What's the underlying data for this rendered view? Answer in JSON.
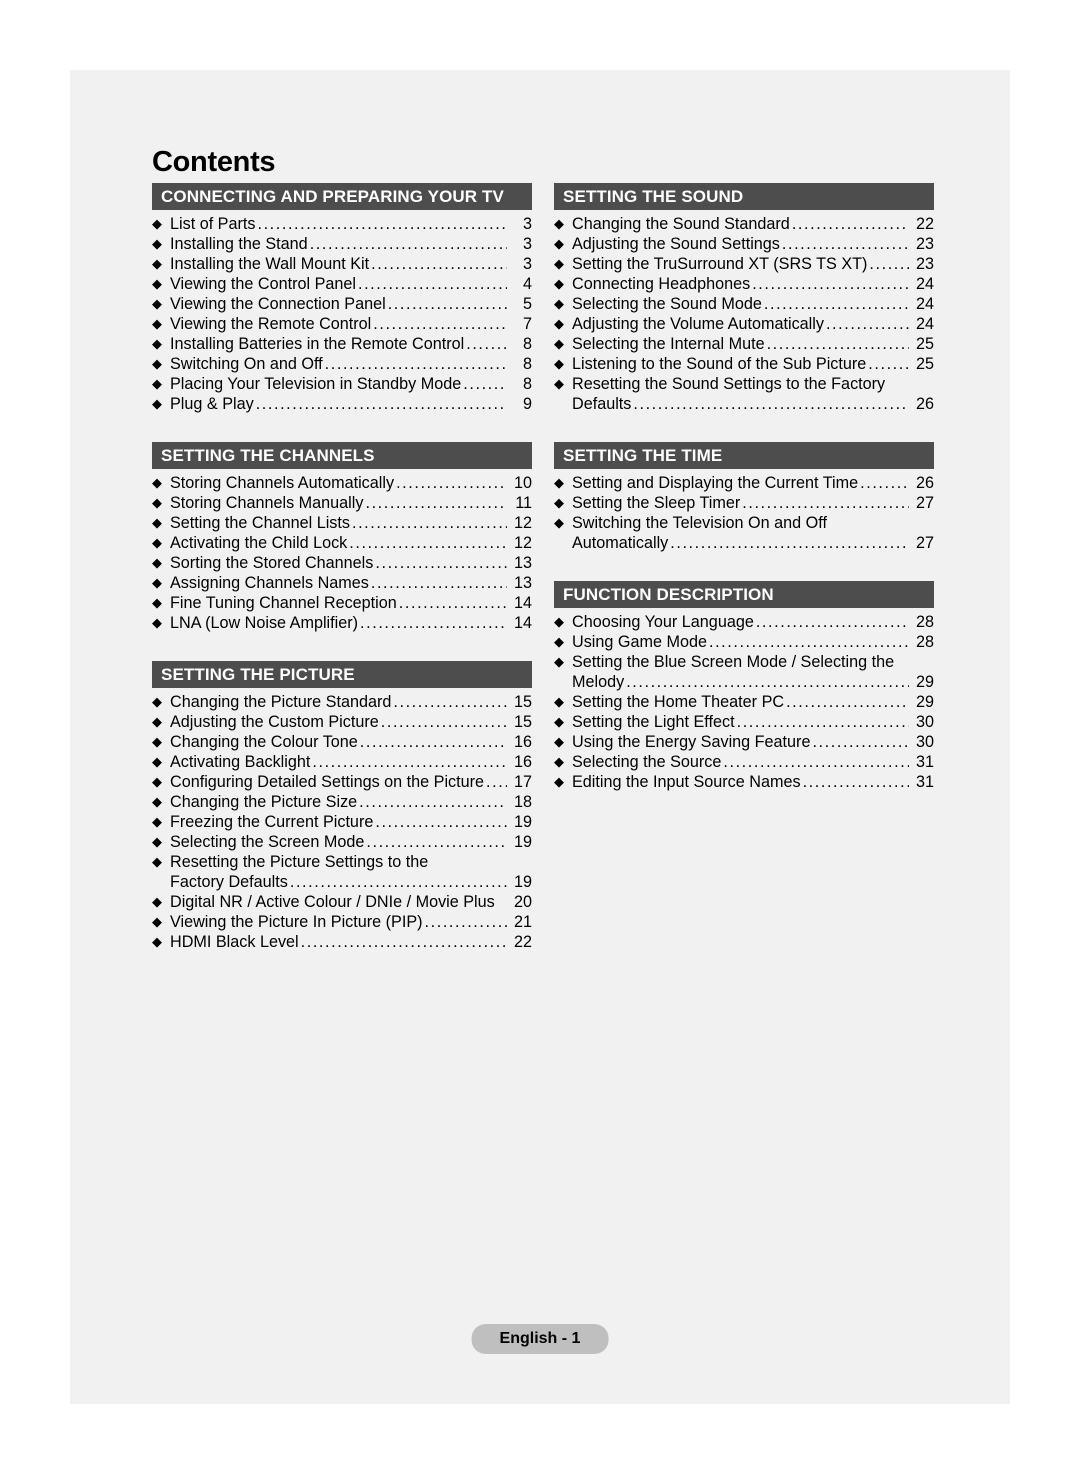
{
  "document": {
    "title": "Contents",
    "bullet_glyph": "◆",
    "footer_label": "English - 1",
    "colors": {
      "page_background": "#f1f1f1",
      "section_bar": "#4d4d4d",
      "section_bar_text": "#ffffff",
      "body_text": "#000000",
      "footer_badge": "#bfbfbf"
    }
  },
  "columns": [
    {
      "name": "left-column",
      "sections": [
        {
          "heading": "CONNECTING AND PREPARING YOUR TV",
          "items": [
            {
              "label": "List of Parts",
              "page": "3",
              "leader": true
            },
            {
              "label": "Installing the Stand",
              "page": "3",
              "leader": true
            },
            {
              "label": "Installing the Wall Mount Kit",
              "page": "3",
              "leader": true
            },
            {
              "label": "Viewing the Control Panel",
              "page": "4",
              "leader": true
            },
            {
              "label": "Viewing the Connection Panel",
              "page": "5",
              "leader": true
            },
            {
              "label": "Viewing the Remote Control",
              "page": "7",
              "leader": true
            },
            {
              "label": "Installing Batteries in the Remote Control",
              "page": "8",
              "leader": true
            },
            {
              "label": "Switching On and Off",
              "page": "8",
              "leader": true
            },
            {
              "label": "Placing Your Television in Standby Mode",
              "page": "8",
              "leader": true
            },
            {
              "label": "Plug & Play",
              "page": "9",
              "leader": true
            }
          ]
        },
        {
          "heading": "SETTING THE CHANNELS",
          "items": [
            {
              "label": "Storing Channels Automatically",
              "page": "10",
              "leader": true
            },
            {
              "label": "Storing Channels Manually",
              "page": "11",
              "leader": true
            },
            {
              "label": "Setting the Channel Lists",
              "page": "12",
              "leader": true
            },
            {
              "label": "Activating the Child Lock",
              "page": "12",
              "leader": true
            },
            {
              "label": "Sorting the Stored Channels",
              "page": "13",
              "leader": true
            },
            {
              "label": "Assigning Channels Names",
              "page": "13",
              "leader": true
            },
            {
              "label": "Fine Tuning Channel Reception",
              "page": "14",
              "leader": true
            },
            {
              "label": "LNA (Low Noise Amplifier)",
              "page": "14",
              "leader": true
            }
          ]
        },
        {
          "heading": "SETTING THE PICTURE",
          "items": [
            {
              "label": "Changing the Picture Standard",
              "page": "15",
              "leader": true
            },
            {
              "label": "Adjusting the Custom Picture",
              "page": "15",
              "leader": true
            },
            {
              "label": "Changing the Colour Tone",
              "page": "16",
              "leader": true
            },
            {
              "label": "Activating Backlight",
              "page": "16",
              "leader": true
            },
            {
              "label": "Configuring Detailed Settings on the Picture",
              "page": "17",
              "leader": true
            },
            {
              "label": "Changing the Picture Size",
              "page": "18",
              "leader": true
            },
            {
              "label": "Freezing the Current Picture",
              "page": "19",
              "leader": true
            },
            {
              "label": "Selecting the Screen Mode",
              "page": "19",
              "leader": true
            },
            {
              "label": "Resetting the Picture Settings to the",
              "continuation": "Factory Defaults",
              "page": "19",
              "leader": true
            },
            {
              "label": "Digital NR / Active Colour / DNIe / Movie Plus",
              "page": "20",
              "leader": false
            },
            {
              "label": "Viewing the Picture In Picture (PIP)",
              "page": "21",
              "leader": true
            },
            {
              "label": "HDMI Black Level",
              "page": "22",
              "leader": true
            }
          ]
        }
      ]
    },
    {
      "name": "right-column",
      "sections": [
        {
          "heading": "SETTING THE SOUND",
          "items": [
            {
              "label": "Changing the Sound Standard",
              "page": "22",
              "leader": true
            },
            {
              "label": "Adjusting the Sound Settings",
              "page": "23",
              "leader": true
            },
            {
              "label": "Setting the TruSurround XT (SRS TS XT)",
              "page": "23",
              "leader": true
            },
            {
              "label": "Connecting Headphones",
              "page": "24",
              "leader": true
            },
            {
              "label": "Selecting the Sound Mode",
              "page": "24",
              "leader": true
            },
            {
              "label": "Adjusting the Volume Automatically",
              "page": "24",
              "leader": true
            },
            {
              "label": "Selecting the Internal Mute",
              "page": "25",
              "leader": true
            },
            {
              "label": "Listening to the Sound of the Sub Picture",
              "page": "25",
              "leader": true
            },
            {
              "label": "Resetting the Sound Settings to the Factory",
              "continuation": "Defaults",
              "page": "26",
              "leader": true
            }
          ]
        },
        {
          "heading": "SETTING THE TIME",
          "items": [
            {
              "label": "Setting and Displaying the Current Time",
              "page": "26",
              "leader": true
            },
            {
              "label": "Setting the Sleep Timer",
              "page": "27",
              "leader": true
            },
            {
              "label": "Switching the Television On and Off",
              "continuation": "Automatically",
              "page": "27",
              "leader": true
            }
          ]
        },
        {
          "heading": "FUNCTION DESCRIPTION",
          "items": [
            {
              "label": "Choosing Your Language",
              "page": "28",
              "leader": true
            },
            {
              "label": "Using Game Mode",
              "page": "28",
              "leader": true
            },
            {
              "label": "Setting the Blue Screen Mode / Selecting the",
              "continuation": "Melody",
              "page": "29",
              "leader": true
            },
            {
              "label": "Setting the Home Theater PC",
              "page": "29",
              "leader": true
            },
            {
              "label": "Setting the Light Effect",
              "page": "30",
              "leader": true
            },
            {
              "label": "Using the Energy Saving Feature",
              "page": "30",
              "leader": true
            },
            {
              "label": "Selecting the Source",
              "page": "31",
              "leader": true
            },
            {
              "label": "Editing the Input Source Names",
              "page": "31",
              "leader": true
            }
          ]
        }
      ]
    }
  ]
}
